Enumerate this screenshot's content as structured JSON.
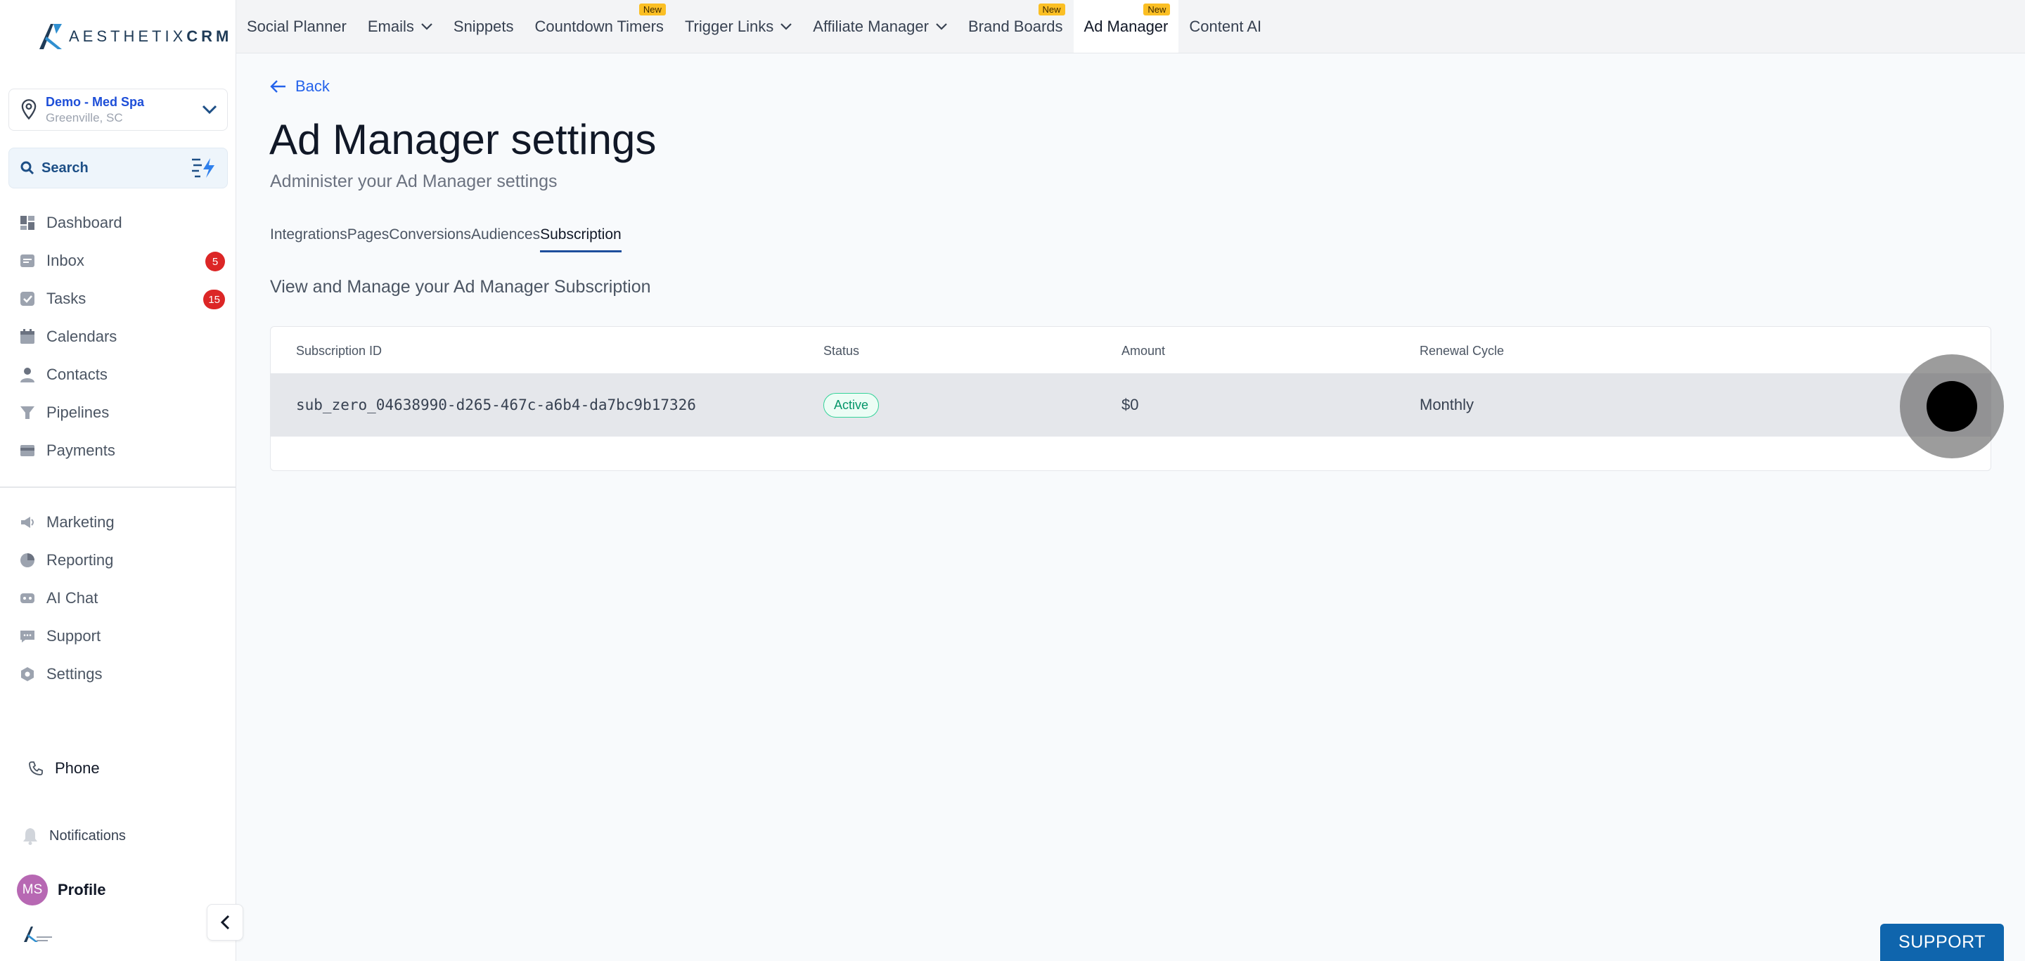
{
  "brand": {
    "logo_text_light": "AESTHETIX",
    "logo_text_bold": "CRM"
  },
  "location": {
    "name": "Demo - Med Spa",
    "city": "Greenville, SC"
  },
  "search": {
    "label": "Search"
  },
  "sidebar": {
    "items": [
      {
        "label": "Dashboard",
        "icon": "dashboard-icon"
      },
      {
        "label": "Inbox",
        "icon": "inbox-icon",
        "badge": "5"
      },
      {
        "label": "Tasks",
        "icon": "tasks-icon",
        "badge": "15"
      },
      {
        "label": "Calendars",
        "icon": "calendar-icon"
      },
      {
        "label": "Contacts",
        "icon": "contacts-icon"
      },
      {
        "label": "Pipelines",
        "icon": "pipelines-icon"
      },
      {
        "label": "Payments",
        "icon": "payments-icon"
      }
    ],
    "items2": [
      {
        "label": "Marketing",
        "icon": "marketing-icon"
      },
      {
        "label": "Reporting",
        "icon": "reporting-icon"
      },
      {
        "label": "AI Chat",
        "icon": "ai-chat-icon"
      },
      {
        "label": "Support",
        "icon": "support-icon"
      },
      {
        "label": "Settings",
        "icon": "settings-icon"
      }
    ],
    "phone": "Phone",
    "notifications": "Notifications",
    "profile": {
      "initials": "MS",
      "label": "Profile"
    }
  },
  "topnav": {
    "items": [
      {
        "label": "Social Planner"
      },
      {
        "label": "Emails",
        "dropdown": true
      },
      {
        "label": "Snippets"
      },
      {
        "label": "Countdown Timers",
        "tag": "New"
      },
      {
        "label": "Trigger Links",
        "dropdown": true
      },
      {
        "label": "Affiliate Manager",
        "dropdown": true
      },
      {
        "label": "Brand Boards",
        "tag": "New"
      },
      {
        "label": "Ad Manager",
        "tag": "New",
        "active": true
      },
      {
        "label": "Content AI"
      }
    ]
  },
  "page": {
    "back": "Back",
    "title": "Ad Manager settings",
    "subtitle": "Administer your Ad Manager settings",
    "tabs": [
      "Integrations",
      "Pages",
      "Conversions",
      "Audiences",
      "Subscription"
    ],
    "active_tab": "Subscription",
    "section_title": "View and Manage your Ad Manager Subscription"
  },
  "table": {
    "headers": [
      "Subscription ID",
      "Status",
      "Amount",
      "Renewal Cycle"
    ],
    "rows": [
      {
        "id": "sub_zero_04638990-d265-467c-a6b4-da7bc9b17326",
        "status": "Active",
        "amount": "$0",
        "cycle": "Monthly"
      }
    ]
  },
  "support_button": "SUPPORT",
  "colors": {
    "accent": "#1e4e9c",
    "badge": "#dc2626",
    "support": "#0f65ad",
    "status_active": "#059669",
    "new_tag": "#fbbf24"
  }
}
